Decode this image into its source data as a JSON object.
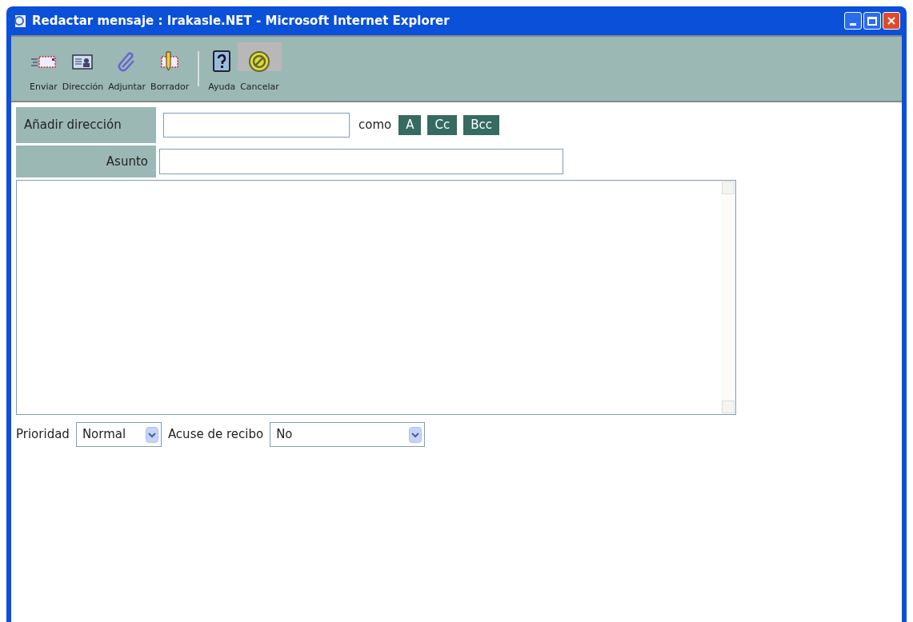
{
  "window": {
    "title": "Redactar mensaje : Irakasle.NET - Microsoft Internet Explorer"
  },
  "toolbar": {
    "groups": [
      [
        {
          "label": "Enviar",
          "kind": "send",
          "selected": false
        },
        {
          "label": "Dirección",
          "kind": "address",
          "selected": false
        },
        {
          "label": "Adjuntar",
          "kind": "attach",
          "selected": false
        },
        {
          "label": "Borrador",
          "kind": "draft",
          "selected": false
        }
      ],
      [
        {
          "label": "Ayuda",
          "kind": "help",
          "selected": false
        },
        {
          "label": "Cancelar",
          "kind": "cancel",
          "selected": true
        }
      ]
    ]
  },
  "address": {
    "label": "Añadir dirección",
    "connector": "como",
    "buttons": [
      "A",
      "Cc",
      "Bcc"
    ]
  },
  "subject": {
    "label": "Asunto"
  },
  "options": [
    {
      "label": "Prioridad",
      "value": "Normal"
    },
    {
      "label": "Acuse de recibo",
      "value": "No"
    }
  ]
}
